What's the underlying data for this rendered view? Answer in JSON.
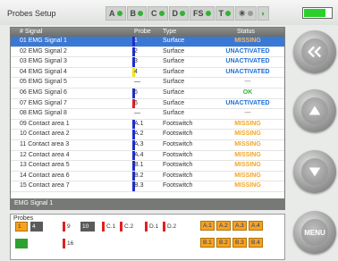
{
  "window": {
    "title": "Probes Setup"
  },
  "indicators": [
    {
      "label": "A",
      "color": "#33b233"
    },
    {
      "label": "B",
      "color": "#33b233"
    },
    {
      "label": "C",
      "color": "#33b233"
    },
    {
      "label": "D",
      "color": "#33b233"
    },
    {
      "label": "FS",
      "color": "#33b233"
    },
    {
      "label": "T",
      "color": "#33b233"
    }
  ],
  "battery": {
    "level": 0.85,
    "color": "#2bd02b"
  },
  "table": {
    "headers": {
      "signal": "# Signal",
      "probe": "Probe",
      "type": "Type",
      "status": "Status"
    },
    "rows": [
      {
        "signal": "01 EMG Signal 1",
        "probe": "1",
        "type": "Surface",
        "status": "MISSING",
        "kind": "missing",
        "bar": "#1f2bd6",
        "selected": true
      },
      {
        "signal": "02 EMG Signal 2",
        "probe": "2",
        "type": "Surface",
        "status": "UNACTIVATED",
        "kind": "unact",
        "bar": "#1f2bd6"
      },
      {
        "signal": "03 EMG Signal 3",
        "probe": "3",
        "type": "Surface",
        "status": "UNACTIVATED",
        "kind": "unact",
        "bar": "#1f2bd6"
      },
      {
        "signal": "04 EMG Signal 4",
        "probe": "4",
        "type": "Surface",
        "status": "UNACTIVATED",
        "kind": "unact",
        "bar": "#f2e41c"
      },
      {
        "signal": "05 EMG Signal 5",
        "probe": "—",
        "type": "Surface",
        "status": "—",
        "kind": "dash",
        "bar": ""
      },
      {
        "signal": "06 EMG Signal 6",
        "probe": "6",
        "type": "Surface",
        "status": "OK",
        "kind": "ok",
        "bar": "#1f2bd6"
      },
      {
        "signal": "07 EMG Signal 7",
        "probe": "6",
        "type": "Surface",
        "status": "UNACTIVATED",
        "kind": "unact",
        "bar": "#e02020"
      },
      {
        "signal": "08 EMG Signal 8",
        "probe": "—",
        "type": "Surface",
        "status": "—",
        "kind": "dash",
        "bar": ""
      },
      {
        "signal": "09 Contact area 1",
        "probe": "A.1",
        "type": "Footswitch",
        "status": "MISSING",
        "kind": "missing",
        "bar": "#1f2bd6"
      },
      {
        "signal": "10 Contact area 2",
        "probe": "A.2",
        "type": "Footswitch",
        "status": "MISSING",
        "kind": "missing",
        "bar": "#1f2bd6"
      },
      {
        "signal": "11 Contact area 3",
        "probe": "A.3",
        "type": "Footswitch",
        "status": "MISSING",
        "kind": "missing",
        "bar": "#1f2bd6"
      },
      {
        "signal": "12 Contact area 4",
        "probe": "A.4",
        "type": "Footswitch",
        "status": "MISSING",
        "kind": "missing",
        "bar": "#1f2bd6"
      },
      {
        "signal": "13 Contact area 5",
        "probe": "B.1",
        "type": "Footswitch",
        "status": "MISSING",
        "kind": "missing",
        "bar": "#1f2bd6"
      },
      {
        "signal": "14 Contact area 6",
        "probe": "B.2",
        "type": "Footswitch",
        "status": "MISSING",
        "kind": "missing",
        "bar": "#1f2bd6"
      },
      {
        "signal": "15 Contact area 7",
        "probe": "B.3",
        "type": "Footswitch",
        "status": "MISSING",
        "kind": "missing",
        "bar": "#1f2bd6"
      }
    ],
    "selected_label": "EMG Signal 1"
  },
  "probes": {
    "title": "Probes",
    "items": [
      {
        "label": "1",
        "style": "orange"
      },
      {
        "label": "4",
        "style": "darkgrey"
      },
      {
        "label": "9",
        "style": "mark",
        "mark": "#e02020"
      },
      {
        "label": "10",
        "style": "darkgrey"
      },
      {
        "label": "C.1",
        "style": "mark",
        "mark": "#e02020"
      },
      {
        "label": "C.2",
        "style": "mark",
        "mark": "#e02020"
      },
      {
        "label": "D.1",
        "style": "mark",
        "mark": "#e02020"
      },
      {
        "label": "D.2",
        "style": "mark",
        "mark": "#e02020"
      },
      {
        "label": "A.1",
        "style": "orange"
      },
      {
        "label": "A.2",
        "style": "orange"
      },
      {
        "label": "A.3",
        "style": "orange"
      },
      {
        "label": "A.4",
        "style": "orange"
      },
      {
        "label": "",
        "style": "green"
      },
      {
        "label": "16",
        "style": "mark",
        "mark": "#e02020"
      },
      {
        "label": "B.1",
        "style": "orange"
      },
      {
        "label": "B.2",
        "style": "orange"
      },
      {
        "label": "B.3",
        "style": "orange"
      },
      {
        "label": "B.4",
        "style": "orange"
      }
    ]
  },
  "buttons": {
    "menu_label": "MENU"
  }
}
